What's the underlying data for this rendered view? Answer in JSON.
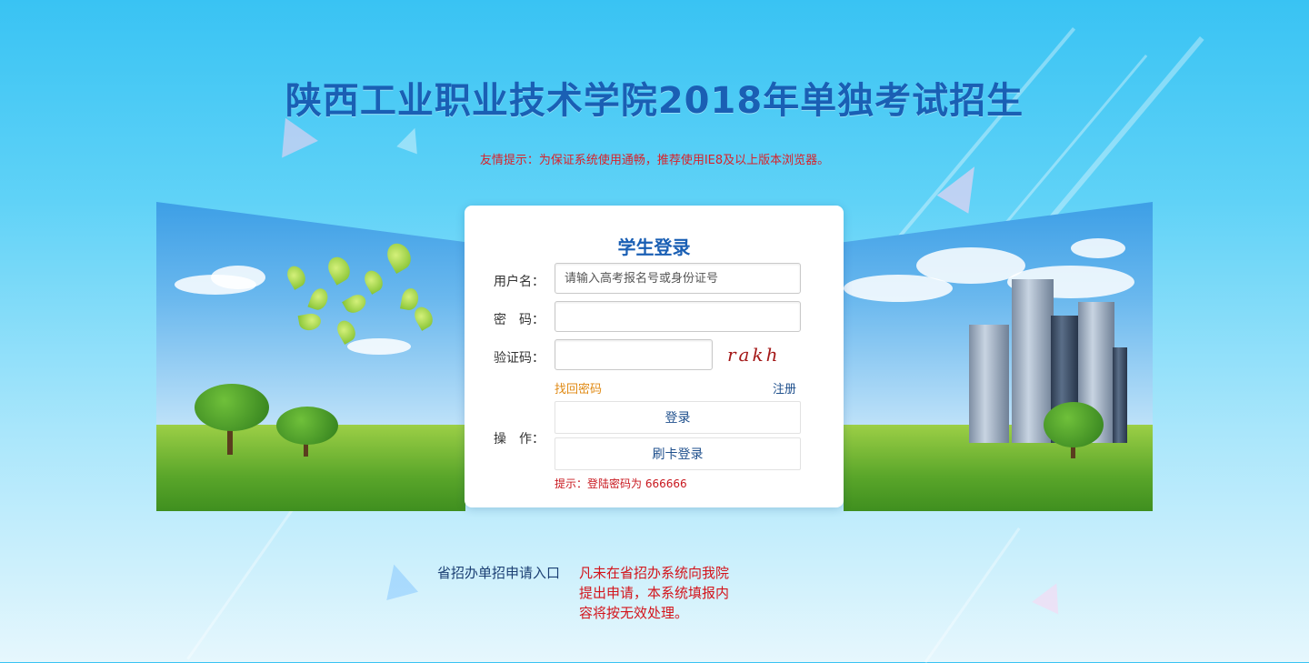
{
  "page": {
    "title": "陕西工业职业技术学院2018年单独考试招生",
    "tip": "友情提示：为保证系统使用通畅，推荐使用IE8及以上版本浏览器。"
  },
  "login": {
    "heading": "学生登录",
    "username_label": "用户名：",
    "username_placeholder": "请输入高考报名号或身份证号",
    "password_label": "密　码：",
    "captcha_label": "验证码：",
    "captcha_text": "rakh",
    "forgot_password": "找回密码",
    "register": "注册",
    "action_label": "操　作：",
    "login_button": "登录",
    "card_login_button": "刷卡登录",
    "hint": "提示：登陆密码为 666666"
  },
  "footer": {
    "provincial_entry": "省招办单招申请入口",
    "notice": "凡未在省招办系统向我院提出申请，本系统填报内容将按无效处理。"
  },
  "colors": {
    "title": "#1a5fb4",
    "warning": "#d8222a",
    "forgot_link": "#e08a14",
    "register_link": "#1e4f8c"
  }
}
